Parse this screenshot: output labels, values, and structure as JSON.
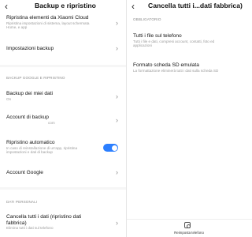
{
  "left": {
    "header": {
      "back_glyph": "‹",
      "title": "Backup e ripristino"
    },
    "rows": {
      "xiaomi_cloud": {
        "title": "Ripristina elementi da Xiaomi Cloud",
        "sub1": "Ripristina impostazioni di sistema, layout schermata",
        "sub2": "Home, e app"
      },
      "backup_settings": {
        "title": "Impostazioni backup"
      },
      "my_data": {
        "title": "Backup dei miei dati",
        "sub": "On"
      },
      "account": {
        "title": "Account di backup",
        "sub": "com"
      },
      "auto_restore": {
        "title": "Ripristino automatico",
        "sub1": "In caso di reinstallazione di un'app, ripristina",
        "sub2": "impostazioni e dati di backup"
      },
      "google_account": {
        "title": "Account Google"
      },
      "factory": {
        "title1": "Cancella tutti i dati (ripristino dati",
        "title2": "fabbrica)",
        "sub": "Elimina tutti i dati sul telefono"
      }
    },
    "sections": {
      "google": "BACKUP GOOGLE E RIPRISTINO",
      "personal": "DATI PERSONALI"
    },
    "toggle_auto_restore": true
  },
  "right": {
    "header": {
      "back_glyph": "‹",
      "title": "Cancella tutti i...dati fabbrica)"
    },
    "section": "OBBLIGATORIO",
    "rows": {
      "all_files": {
        "title": "Tutti i file sul telefono",
        "sub1": "Tutti i file e dati, compresi account, contatti, foto ed",
        "sub2": "applicazioni"
      },
      "sd_format": {
        "title": "Formato scheda SD emulata",
        "sub": "La formattazione eliminerà tutti i dati sulla scheda SD"
      }
    },
    "footer": {
      "reset_label": "Reimposta telefono"
    }
  },
  "colors": {
    "toggle_on": "#2c7fff",
    "secondary_text": "#9a9a9a"
  }
}
